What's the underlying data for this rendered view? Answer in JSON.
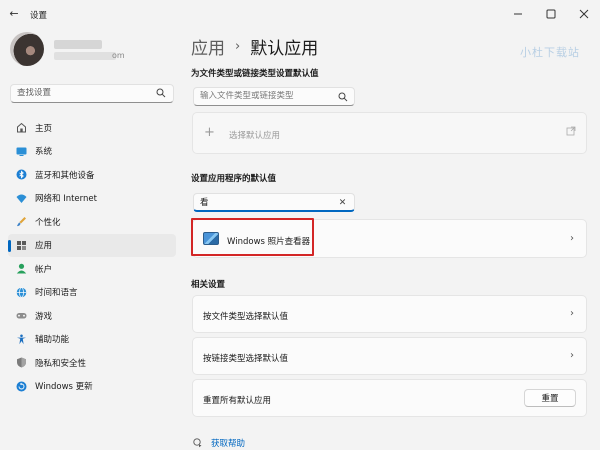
{
  "window": {
    "title": "设置",
    "back_icon": "back-arrow-icon",
    "controls": [
      "minimize-icon",
      "maximize-icon",
      "close-icon"
    ]
  },
  "account": {
    "email_suffix": "om"
  },
  "sidebar": {
    "search_placeholder": "查找设置",
    "items": [
      {
        "label": "主页",
        "icon": "home-icon",
        "active": false
      },
      {
        "label": "系统",
        "icon": "system-icon",
        "active": false
      },
      {
        "label": "蓝牙和其他设备",
        "icon": "bluetooth-icon",
        "active": false
      },
      {
        "label": "网络和 Internet",
        "icon": "wifi-icon",
        "active": false
      },
      {
        "label": "个性化",
        "icon": "brush-icon",
        "active": false
      },
      {
        "label": "应用",
        "icon": "apps-icon",
        "active": true
      },
      {
        "label": "帐户",
        "icon": "account-icon",
        "active": false
      },
      {
        "label": "时间和语言",
        "icon": "globe-clock-icon",
        "active": false
      },
      {
        "label": "游戏",
        "icon": "gamepad-icon",
        "active": false
      },
      {
        "label": "辅助功能",
        "icon": "accessibility-icon",
        "active": false
      },
      {
        "label": "隐私和安全性",
        "icon": "shield-icon",
        "active": false
      },
      {
        "label": "Windows 更新",
        "icon": "update-icon",
        "active": false
      }
    ]
  },
  "header": {
    "parent": "应用",
    "separator": "›",
    "current": "默认应用",
    "watermark": "小杜下载站"
  },
  "file_types": {
    "heading": "为文件类型或链接类型设置默认值",
    "input_placeholder": "输入文件类型或链接类型",
    "choose_default_label": "选择默认应用"
  },
  "app_defaults": {
    "heading": "设置应用程序的默认值",
    "search_value": "看",
    "result_name": "Windows 照片查看器"
  },
  "related": {
    "heading": "相关设置",
    "by_file_type": "按文件类型选择默认值",
    "by_link_type": "按链接类型选择默认值",
    "reset_label": "重置所有默认应用",
    "reset_button": "重置"
  },
  "help": {
    "label": "获取帮助"
  },
  "colors": {
    "accent": "#0067c0",
    "highlight_border": "#d32626",
    "background": "#f3f3f3",
    "card": "#fbfbfb"
  }
}
